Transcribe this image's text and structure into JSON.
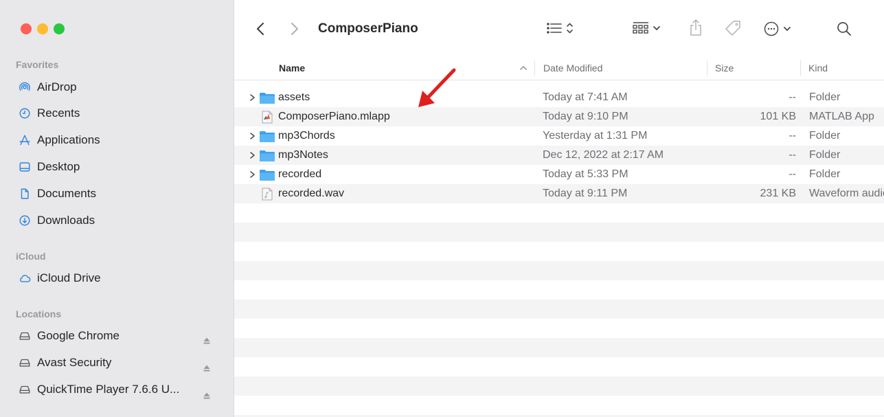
{
  "window": {
    "title": "ComposerPiano"
  },
  "colors": {
    "accent": "#2e86de",
    "folder": "#3ea1ee",
    "annotation_arrow": "#e01f1f"
  },
  "sidebar": {
    "sections": [
      {
        "title": "Favorites",
        "items": [
          {
            "label": "AirDrop",
            "icon": "airdrop-icon"
          },
          {
            "label": "Recents",
            "icon": "clock-icon"
          },
          {
            "label": "Applications",
            "icon": "applications-icon"
          },
          {
            "label": "Desktop",
            "icon": "desktop-icon"
          },
          {
            "label": "Documents",
            "icon": "document-icon"
          },
          {
            "label": "Downloads",
            "icon": "download-icon"
          }
        ]
      },
      {
        "title": "iCloud",
        "items": [
          {
            "label": "iCloud Drive",
            "icon": "cloud-icon"
          }
        ]
      },
      {
        "title": "Locations",
        "items": [
          {
            "label": "Google Chrome",
            "icon": "drive-icon",
            "eject": true
          },
          {
            "label": "Avast Security",
            "icon": "drive-icon",
            "eject": true
          },
          {
            "label": "QuickTime Player 7.6.6 U...",
            "icon": "drive-icon",
            "eject": true
          }
        ]
      }
    ]
  },
  "toolbar": {
    "icons": [
      "back-icon",
      "forward-icon",
      "list-view-icon",
      "group-icon",
      "share-icon",
      "tag-icon",
      "more-icon",
      "search-icon"
    ]
  },
  "columns": {
    "name": "Name",
    "date": "Date Modified",
    "size": "Size",
    "kind": "Kind"
  },
  "files": [
    {
      "name": "assets",
      "date": "Today at 7:41 AM",
      "size": "--",
      "kind": "Folder",
      "type": "folder",
      "expandable": true
    },
    {
      "name": "ComposerPiano.mlapp",
      "date": "Today at 9:10 PM",
      "size": "101 KB",
      "kind": "MATLAB App",
      "type": "mlapp",
      "expandable": false
    },
    {
      "name": "mp3Chords",
      "date": "Yesterday at 1:31 PM",
      "size": "--",
      "kind": "Folder",
      "type": "folder",
      "expandable": true
    },
    {
      "name": "mp3Notes",
      "date": "Dec 12, 2022 at 2:17 AM",
      "size": "--",
      "kind": "Folder",
      "type": "folder",
      "expandable": true
    },
    {
      "name": "recorded",
      "date": "Today at 5:33 PM",
      "size": "--",
      "kind": "Folder",
      "type": "folder",
      "expandable": true
    },
    {
      "name": "recorded.wav",
      "date": "Today at 9:11 PM",
      "size": "231 KB",
      "kind": "Waveform audio",
      "type": "audio",
      "expandable": false
    }
  ]
}
